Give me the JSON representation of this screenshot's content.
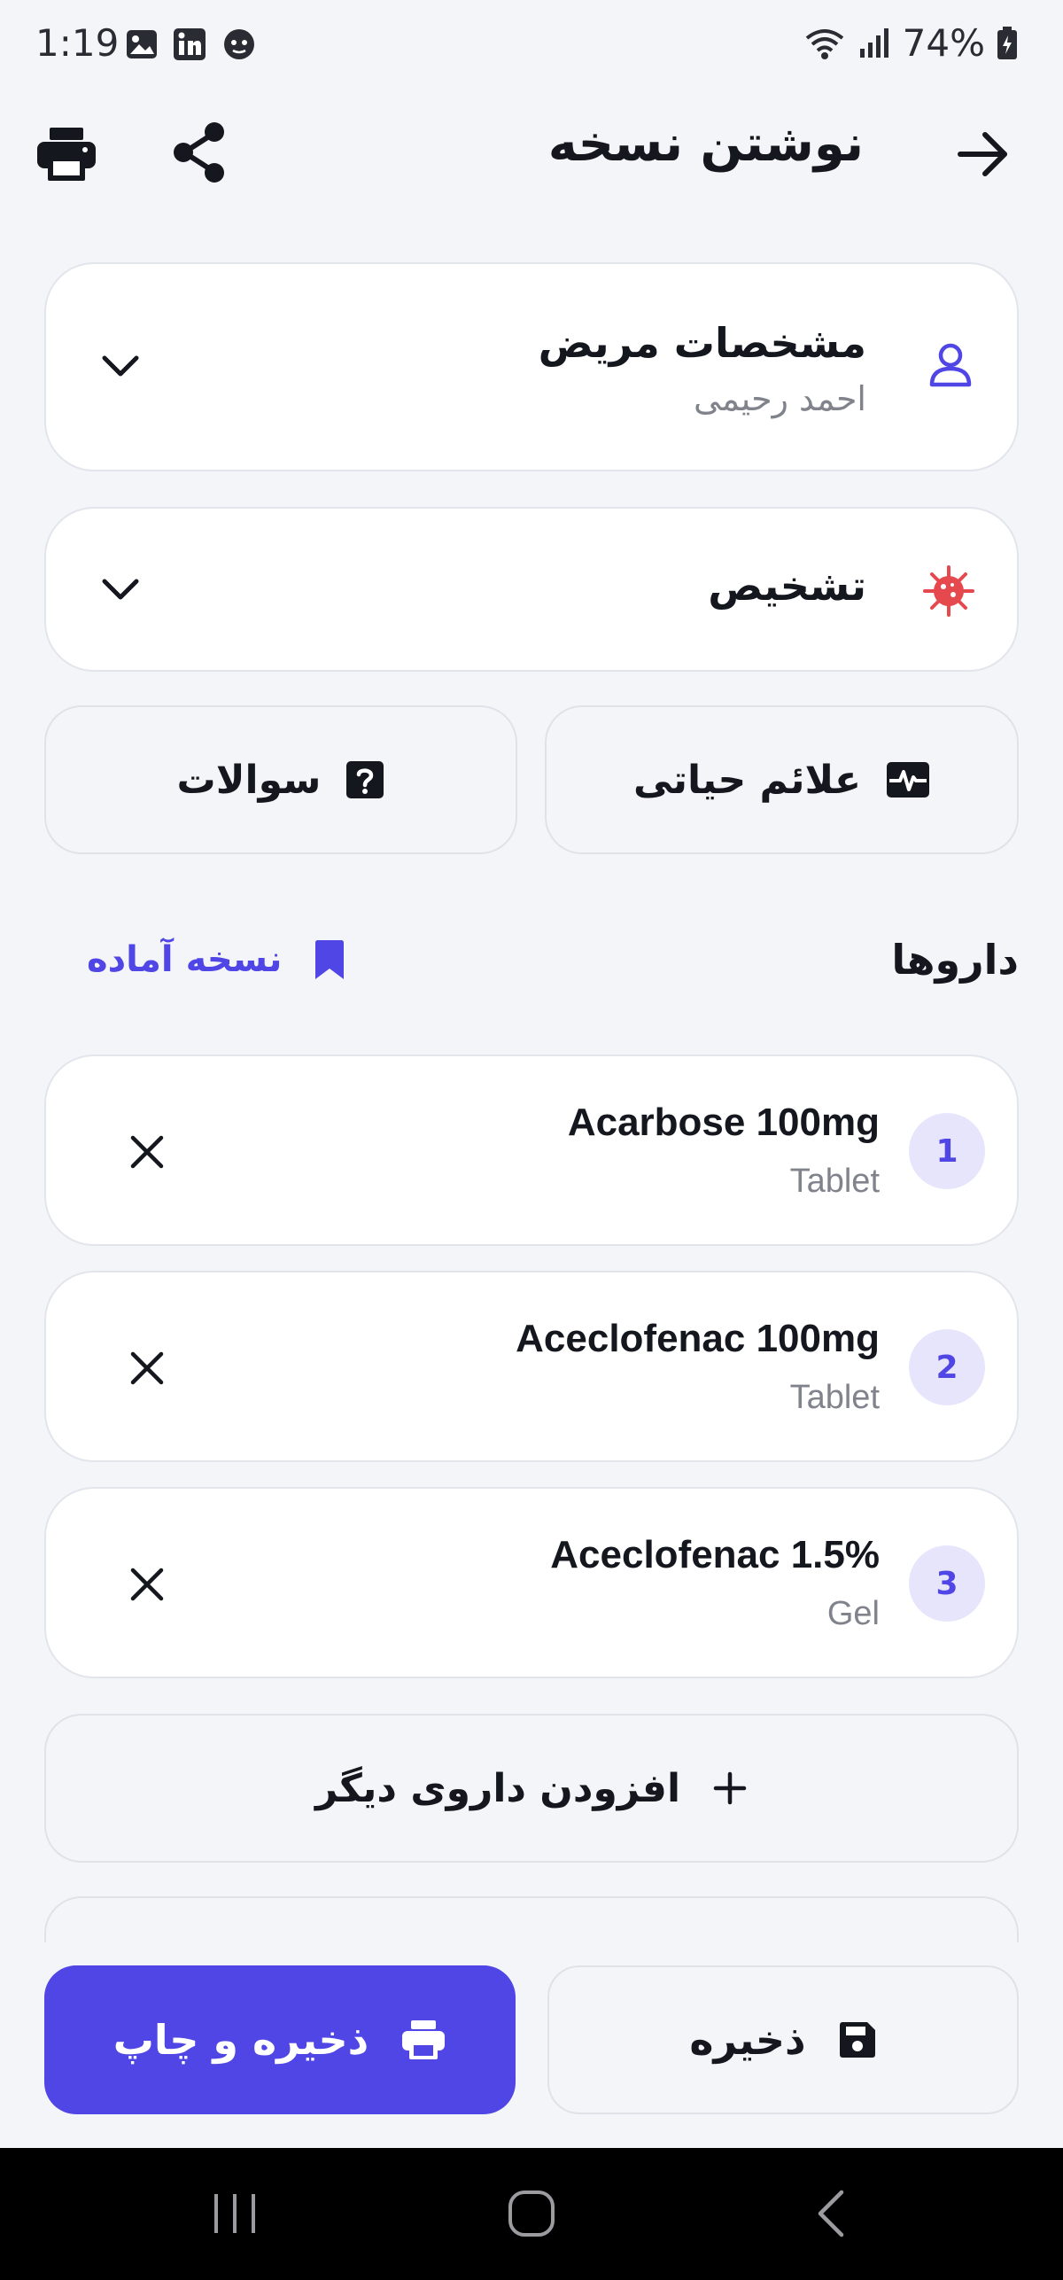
{
  "status_bar": {
    "time": "1:19",
    "battery": "74%",
    "icons": [
      "image-icon",
      "linkedin-icon",
      "app-icon",
      "wifi-icon",
      "signal-icon",
      "battery-icon"
    ]
  },
  "app_bar": {
    "title": "نوشتن نسخه",
    "icons": [
      "back-arrow-icon",
      "share-icon",
      "print-icon"
    ]
  },
  "patient_card": {
    "title": "مشخصات مریض",
    "name": "احمد رحیمی"
  },
  "diagnosis_card": {
    "title": "تشخیص"
  },
  "quick_buttons": {
    "vitals": "علائم حیاتی",
    "questions": "سوالات"
  },
  "drugs_section": {
    "title": "داروها",
    "ready_prescription": "نسخه آماده",
    "items": [
      {
        "number": "1",
        "name": "Acarbose 100mg",
        "form": "Tablet"
      },
      {
        "number": "2",
        "name": "Aceclofenac 100mg",
        "form": "Tablet"
      },
      {
        "number": "3",
        "name": "Aceclofenac 1.5%",
        "form": "Gel"
      }
    ],
    "add_drug": "افزودن داروی دیگر"
  },
  "actions": {
    "save_print": "ذخیره و چاپ",
    "save": "ذخیره"
  },
  "colors": {
    "accent": "#5046e5",
    "accent_light": "#e7e5fb",
    "diagnosis_icon": "#e5484d",
    "background": "#f4f5f9"
  }
}
